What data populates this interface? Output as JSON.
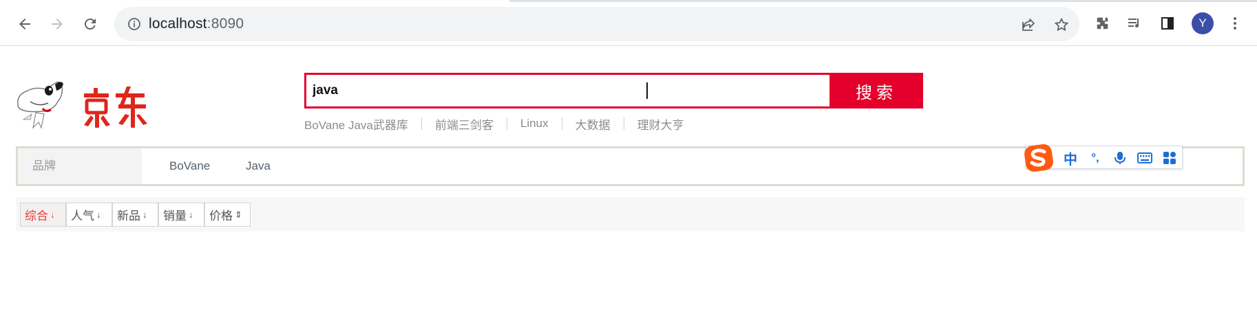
{
  "browser": {
    "url_host": "localhost",
    "url_port": ":8090",
    "avatar_letter": "Y",
    "icons": [
      "back-icon",
      "forward-icon",
      "reload-icon",
      "info-icon",
      "share-icon",
      "star-icon",
      "extensions-icon",
      "media-icon",
      "sidepanel-icon",
      "menu-icon"
    ]
  },
  "logo": {
    "text": "京东"
  },
  "search": {
    "value": "java",
    "button_label": "搜索"
  },
  "hot_words": [
    "BoVane Java武器库",
    "前端三剑客",
    "Linux",
    "大数据",
    "理财大亨"
  ],
  "brand_filter": {
    "label": "品牌",
    "items": [
      "BoVane",
      "Java"
    ]
  },
  "ime_toolbar": {
    "items": [
      "中",
      "°,",
      "mic-icon",
      "keyboard-icon",
      "apps-icon"
    ]
  },
  "sort_bar": {
    "items": [
      {
        "label": "综合",
        "indicator": "↓",
        "active": true
      },
      {
        "label": "人气",
        "indicator": "↓",
        "active": false
      },
      {
        "label": "新品",
        "indicator": "↓",
        "active": false
      },
      {
        "label": "销量",
        "indicator": "↓",
        "active": false
      },
      {
        "label": "价格",
        "indicator": "⇕",
        "active": false
      }
    ]
  },
  "colors": {
    "accent": "#e4002b",
    "active_sort": "#e4393c",
    "brand_border": "#dcdcd4",
    "ime_blue": "#1e6fd0"
  }
}
